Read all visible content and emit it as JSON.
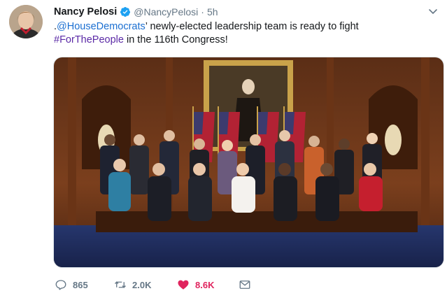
{
  "author": {
    "name": "Nancy Pelosi",
    "handle": "@NancyPelosi",
    "separator": "·",
    "time": "5h"
  },
  "icons": {
    "verified": "verified-badge-icon",
    "caret": "chevron-down-icon",
    "reply": "reply-icon",
    "retweet": "retweet-icon",
    "like": "heart-icon",
    "message": "envelope-icon"
  },
  "tweet": {
    "prefix": ".",
    "mention": "@HouseDemocrats",
    "text_1": "’ newly-elected leadership team is ready to fight",
    "hashtag": "#ForThePeople",
    "text_2": " in the 116th Congress!"
  },
  "stats": {
    "replies": "865",
    "retweets": "2.0K",
    "likes": "8.6K"
  },
  "colors": {
    "link": "#1b6fd1",
    "hashtag": "#5b2aa6",
    "like": "#e0245e",
    "verified": "#1da1f2",
    "muted": "#657786"
  }
}
